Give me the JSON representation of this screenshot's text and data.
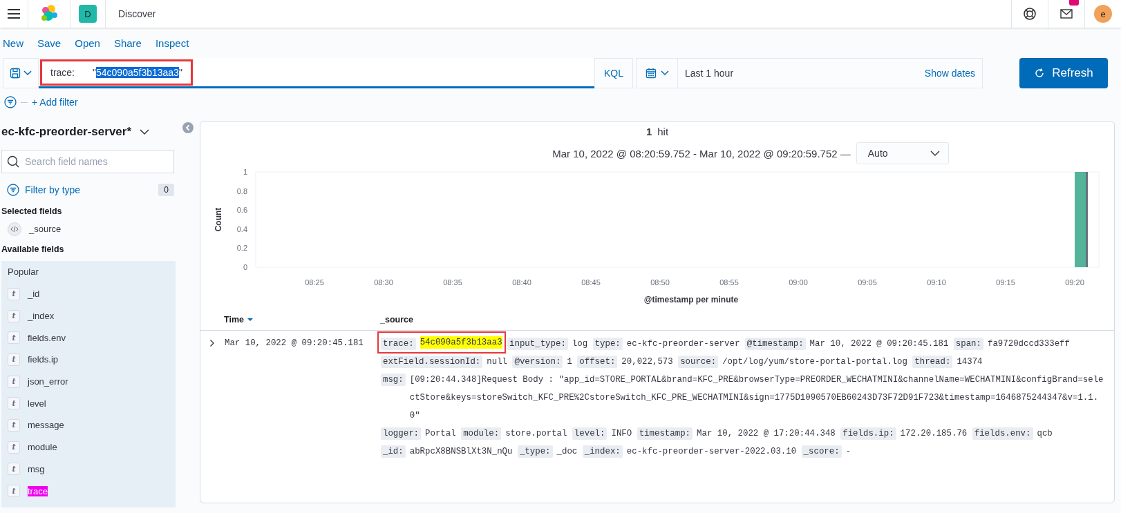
{
  "header": {
    "space_badge": "D",
    "title": "Discover",
    "avatar": "e"
  },
  "top_menu": [
    "New",
    "Save",
    "Open",
    "Share",
    "Inspect"
  ],
  "query": {
    "annotated": true,
    "parts": [
      {
        "text": "trace:",
        "selected": false
      },
      {
        "text": "\"",
        "selected": false
      },
      {
        "text": "54c090a5f3b13aa3",
        "selected": true
      },
      {
        "text": "\"",
        "selected": false
      }
    ],
    "language": "KQL"
  },
  "date_picker": {
    "range": "Last 1 hour",
    "show_dates": "Show dates"
  },
  "refresh": "Refresh",
  "add_filter": "+ Add filter",
  "sidebar": {
    "index_pattern": "ec-kfc-preorder-server*",
    "search_placeholder": "Search field names",
    "filter_by_type": "Filter by type",
    "filter_count": "0",
    "selected_title": "Selected fields",
    "selected_fields": [
      {
        "kind": "source",
        "name": "_source",
        "highlight": false
      }
    ],
    "available_title": "Available fields",
    "popular_title": "Popular",
    "popular_fields": [
      {
        "kind": "text",
        "type": "t",
        "name": "_id",
        "highlight": false
      },
      {
        "kind": "text",
        "type": "t",
        "name": "_index",
        "highlight": false
      },
      {
        "kind": "text",
        "type": "t",
        "name": "fields.env",
        "highlight": false
      },
      {
        "kind": "text",
        "type": "t",
        "name": "fields.ip",
        "highlight": false
      },
      {
        "kind": "text",
        "type": "t",
        "name": "json_error",
        "highlight": false
      },
      {
        "kind": "text",
        "type": "t",
        "name": "level",
        "highlight": false
      },
      {
        "kind": "text",
        "type": "t",
        "name": "message",
        "highlight": false
      },
      {
        "kind": "text",
        "type": "t",
        "name": "module",
        "highlight": false
      },
      {
        "kind": "text",
        "type": "t",
        "name": "msg",
        "highlight": false
      },
      {
        "kind": "text",
        "type": "t",
        "name": "trace",
        "highlight": true
      }
    ]
  },
  "histogram": {
    "hits": "1",
    "hits_label": "hit",
    "range": "Mar 10, 2022 @ 08:20:59.752 - Mar 10, 2022 @ 09:20:59.752 —",
    "interval": "Auto",
    "chart_data": {
      "type": "bar",
      "xlabel": "@timestamp per minute",
      "ylabel": "Count",
      "categories": [
        "08:25",
        "08:30",
        "08:35",
        "08:40",
        "08:45",
        "08:50",
        "08:55",
        "09:00",
        "09:05",
        "09:10",
        "09:15",
        "09:20"
      ],
      "series": [
        {
          "color": "#54b399",
          "values": [
            0,
            0,
            0,
            0,
            0,
            0,
            0,
            0,
            0,
            0,
            0,
            1
          ]
        }
      ],
      "ylim": [
        0,
        1
      ],
      "yticks": [
        0,
        0.2,
        0.4,
        0.6,
        0.8,
        1
      ]
    }
  },
  "table": {
    "columns": [
      {
        "label": "Time",
        "sorted": true
      },
      {
        "label": "_source",
        "sorted": false
      }
    ],
    "rows": [
      {
        "time": "Mar 10, 2022 @ 09:20:45.181",
        "expanded": false,
        "fields": [
          {
            "key": "trace:",
            "value": "54c090a5f3b13aa3",
            "highlight": true,
            "annotated": true
          },
          {
            "key": "input_type:",
            "value": "log",
            "highlight": false,
            "annotated": false
          },
          {
            "key": "type:",
            "value": "ec-kfc-preorder-server",
            "highlight": false,
            "annotated": false
          },
          {
            "key": "@timestamp:",
            "value": "Mar 10, 2022 @ 09:20:45.181",
            "highlight": false,
            "annotated": false
          },
          {
            "key": "span:",
            "value": "fa9720dccd333eff",
            "highlight": false,
            "annotated": false
          },
          {
            "key": "extField.sessionId:",
            "value": "null",
            "highlight": false,
            "annotated": false
          },
          {
            "key": "@version:",
            "value": "1",
            "highlight": false,
            "annotated": false
          },
          {
            "key": "offset:",
            "value": "20,022,573",
            "highlight": false,
            "annotated": false
          },
          {
            "key": "source:",
            "value": "/opt/log/yum/store-portal-portal.log",
            "highlight": false,
            "annotated": false
          },
          {
            "key": "thread:",
            "value": "14374",
            "highlight": false,
            "annotated": false
          },
          {
            "key": "msg:",
            "value": "[09:20:44.348]Request Body : \"app_id=STORE_PORTAL&brand=KFC_PRE&browserType=PREORDER_WECHATMINI&channelName=WECHATMINI&configBrand=selectStore&keys=storeSwitch_KFC_PRE%2CstoreSwitch_KFC_PRE_WECHATMINI&sign=1775D1090570EB60243D73F72D91F723&timestamp=1646875244347&v=1.1.0\"",
            "highlight": false,
            "annotated": false
          },
          {
            "key": "logger:",
            "value": "Portal",
            "highlight": false,
            "annotated": false
          },
          {
            "key": "module:",
            "value": "store.portal",
            "highlight": false,
            "annotated": false
          },
          {
            "key": "level:",
            "value": "INFO",
            "highlight": false,
            "annotated": false
          },
          {
            "key": "timestamp:",
            "value": "Mar 10, 2022 @ 17:20:44.348",
            "highlight": false,
            "annotated": false
          },
          {
            "key": "fields.ip:",
            "value": "172.20.185.76",
            "highlight": false,
            "annotated": false
          },
          {
            "key": "fields.env:",
            "value": "qcb",
            "highlight": false,
            "annotated": false
          },
          {
            "key": "_id:",
            "value": "abRpcX8BNSBlXt3N_nQu",
            "highlight": false,
            "annotated": false
          },
          {
            "key": "_type:",
            "value": "_doc",
            "highlight": false,
            "annotated": false
          },
          {
            "key": "_index:",
            "value": "ec-kfc-preorder-server-2022.03.10",
            "highlight": false,
            "annotated": false
          },
          {
            "key": "_score:",
            "value": "-",
            "highlight": false,
            "annotated": false
          }
        ]
      }
    ]
  }
}
